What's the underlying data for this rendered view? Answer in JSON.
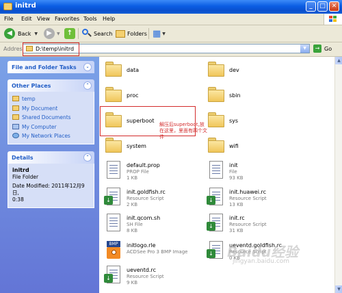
{
  "window": {
    "title": "initrd",
    "minimize_glyph": "_",
    "maximize_glyph": "□",
    "close_glyph": "✕"
  },
  "menu": [
    "File",
    "Edit",
    "View",
    "Favorites",
    "Tools",
    "Help"
  ],
  "toolbar": {
    "back_label": "Back",
    "back_glyph": "◀",
    "forward_glyph": "▶",
    "up_glyph": "↑",
    "search_label": "Search",
    "folders_label": "Folders",
    "views_glyph": "▦"
  },
  "address": {
    "label": "Address",
    "path": "D:\\temp\\initrd",
    "go_label": "Go",
    "go_glyph": "→",
    "dropdown_glyph": "▼"
  },
  "sidebar": {
    "file_folder_tasks": {
      "title": "File and Folder Tasks",
      "chevron": "⌄"
    },
    "other_places": {
      "title": "Other Places",
      "chevron": "⌃",
      "items": [
        {
          "label": "temp",
          "icon": "folder-icon"
        },
        {
          "label": "My Document",
          "icon": "my-documents-icon"
        },
        {
          "label": "Shared Documents",
          "icon": "shared-documents-icon"
        },
        {
          "label": "My Computer",
          "icon": "my-computer-icon"
        },
        {
          "label": "My Network Places",
          "icon": "network-places-icon"
        }
      ]
    },
    "details": {
      "title": "Details",
      "chevron": "⌃",
      "name": "initrd",
      "type": "File Folder",
      "modified_line1": "Date Modified: 2011年12月9日,",
      "modified_line2": "0:38"
    }
  },
  "files": [
    {
      "name": "data",
      "kind": "folder"
    },
    {
      "name": "dev",
      "kind": "folder"
    },
    {
      "name": "proc",
      "kind": "folder"
    },
    {
      "name": "sbin",
      "kind": "folder"
    },
    {
      "name": "superboot",
      "kind": "folder"
    },
    {
      "name": "sys",
      "kind": "folder"
    },
    {
      "name": "system",
      "kind": "folder"
    },
    {
      "name": "wifi",
      "kind": "folder"
    },
    {
      "name": "default.prop",
      "type": "PROP File",
      "size": "1 KB",
      "kind": "doc"
    },
    {
      "name": "init",
      "type": "File",
      "size": "93 KB",
      "kind": "doc"
    },
    {
      "name": "init.goldfish.rc",
      "type": "Resource Script",
      "size": "2 KB",
      "kind": "script"
    },
    {
      "name": "init.huawei.rc",
      "type": "Resource Script",
      "size": "13 KB",
      "kind": "script"
    },
    {
      "name": "init.qcom.sh",
      "type": "SH File",
      "size": "8 KB",
      "kind": "doc"
    },
    {
      "name": "init.rc",
      "type": "Resource Script",
      "size": "31 KB",
      "kind": "script"
    },
    {
      "name": "initlogo.rle",
      "type": "ACDSee Pro 3 BMP Image",
      "size": "",
      "kind": "bmp",
      "badge": "BMP"
    },
    {
      "name": "ueventd.goldfish.rc",
      "type": "Resource Script",
      "size": "0 KB",
      "kind": "script"
    },
    {
      "name": "ueventd.rc",
      "type": "Resource Script",
      "size": "9 KB",
      "kind": "script"
    }
  ],
  "annotation": "解压后superboot,放在这里，里面有四个文件",
  "watermark": {
    "brand": "Baidu经验",
    "url": "jingyan.baidu.com"
  },
  "colors": {
    "titlebar": "#0b5de3",
    "sidebar": "#6f8fdf",
    "highlight": "#d32b2b",
    "link": "#215dc6"
  }
}
